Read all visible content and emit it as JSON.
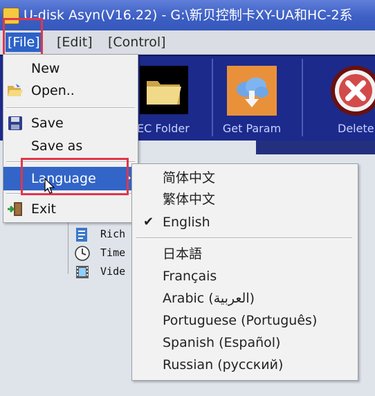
{
  "window": {
    "title": "U-disk Asyn(V16.22) - G:\\新贝控制卡XY-UA和HC-2系"
  },
  "menubar": {
    "file": "[File]",
    "edit": "[Edit]",
    "control": "[Control]"
  },
  "toolbar": {
    "buttons": [
      {
        "label": "EC Folder",
        "icon": "folder-icon"
      },
      {
        "label": "Get Param",
        "icon": "cloud-download-icon"
      },
      {
        "label": "Delete",
        "icon": "delete-x-icon"
      }
    ]
  },
  "file_menu": {
    "items": [
      {
        "label": "New"
      },
      {
        "label": "Open..",
        "icon": "open-folder-icon"
      },
      {
        "label": "Save",
        "icon": "floppy-disk-icon"
      },
      {
        "label": "Save as"
      },
      {
        "label": "Language"
      },
      {
        "label": "Exit",
        "icon": "exit-door-icon"
      }
    ]
  },
  "language_menu": {
    "items": [
      {
        "label": "简体中文",
        "checked": false
      },
      {
        "label": "繁体中文",
        "checked": false
      },
      {
        "label": "English",
        "checked": true
      },
      {
        "label": "日本語",
        "checked": false
      },
      {
        "label": "Français",
        "checked": false
      },
      {
        "label": "Arabic (العربية)",
        "checked": false
      },
      {
        "label": "Portuguese (Português)",
        "checked": false
      },
      {
        "label": "Spanish (Español)",
        "checked": false
      },
      {
        "label": "Russian (русский)",
        "checked": false
      }
    ],
    "check_mark": "✔"
  },
  "tree": {
    "items": [
      {
        "label": "Rich",
        "icon": "rich-text-icon"
      },
      {
        "label": "Time",
        "icon": "clock-icon"
      },
      {
        "label": "Vide",
        "icon": "video-film-icon"
      }
    ]
  },
  "colors": {
    "menu_highlight": "#3265c7",
    "annotation_red": "#e2364a",
    "toolbar_bg": "#1c2a8c"
  }
}
